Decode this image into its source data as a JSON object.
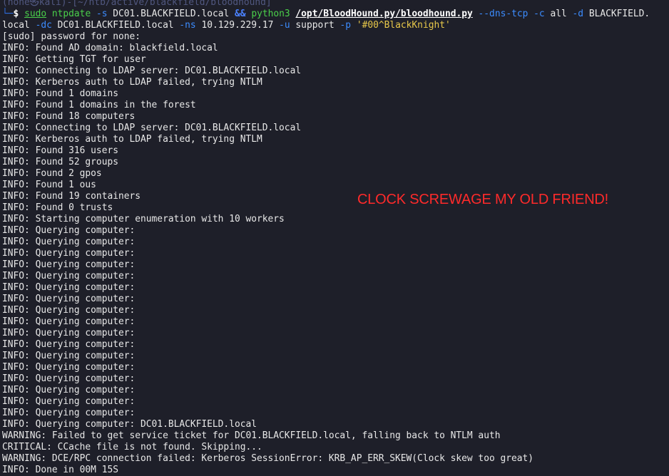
{
  "terminal": {
    "top_partial_line": "(none㉿kali)-[~/htb/active/blackfield/bloodhound]",
    "prompt": {
      "corner": "└─",
      "dollar": "$",
      "sudo": "sudo",
      "ntpdate": "ntpdate",
      "s_flag": "-s",
      "s_value": "DC01.BLACKFIELD.local",
      "and": "&&",
      "python": "python3",
      "script": "/opt/BloodHound.py/bloodhound.py",
      "dns_flag": "--dns-tcp",
      "c_flag": "-c",
      "c_value": "all",
      "d_flag": "-d",
      "d_value": "BLACKFIELD."
    },
    "continuation": {
      "d_value_rest": "local",
      "dc_flag": "-dc",
      "dc_value": "DC01.BLACKFIELD.local",
      "ns_flag": "-ns",
      "ns_value": "10.129.229.17",
      "u_flag": "-u",
      "u_value": "support",
      "p_flag": "-p",
      "p_value": "'#00^BlackKnight'"
    },
    "output": [
      "[sudo] password for none:",
      "INFO: Found AD domain: blackfield.local",
      "INFO: Getting TGT for user",
      "INFO: Connecting to LDAP server: DC01.BLACKFIELD.local",
      "INFO: Kerberos auth to LDAP failed, trying NTLM",
      "INFO: Found 1 domains",
      "INFO: Found 1 domains in the forest",
      "INFO: Found 18 computers",
      "INFO: Connecting to LDAP server: DC01.BLACKFIELD.local",
      "INFO: Kerberos auth to LDAP failed, trying NTLM",
      "INFO: Found 316 users",
      "INFO: Found 52 groups",
      "INFO: Found 2 gpos",
      "INFO: Found 1 ous",
      "INFO: Found 19 containers",
      "INFO: Found 0 trusts",
      "INFO: Starting computer enumeration with 10 workers",
      "INFO: Querying computer:",
      "INFO: Querying computer:",
      "INFO: Querying computer:",
      "INFO: Querying computer:",
      "INFO: Querying computer:",
      "INFO: Querying computer:",
      "INFO: Querying computer:",
      "INFO: Querying computer:",
      "INFO: Querying computer:",
      "INFO: Querying computer:",
      "INFO: Querying computer:",
      "INFO: Querying computer:",
      "INFO: Querying computer:",
      "INFO: Querying computer:",
      "INFO: Querying computer:",
      "INFO: Querying computer:",
      "INFO: Querying computer:",
      "INFO: Querying computer: DC01.BLACKFIELD.local",
      "WARNING: Failed to get service ticket for DC01.BLACKFIELD.local, falling back to NTLM auth",
      "CRITICAL: CCache file is not found. Skipping...",
      "WARNING: DCE/RPC connection failed: Kerberos SessionError: KRB_AP_ERR_SKEW(Clock skew too great)",
      "INFO: Done in 00M 15S"
    ]
  },
  "annotation": {
    "text": "CLOCK SCREWAGE MY OLD FRIEND!",
    "color": "#ff2a2a"
  },
  "colors": {
    "background": "#1e1f29",
    "command": "#4ad04a",
    "flag": "#3c8cff",
    "string": "#e8c84a",
    "text": "#e8e8e8"
  }
}
